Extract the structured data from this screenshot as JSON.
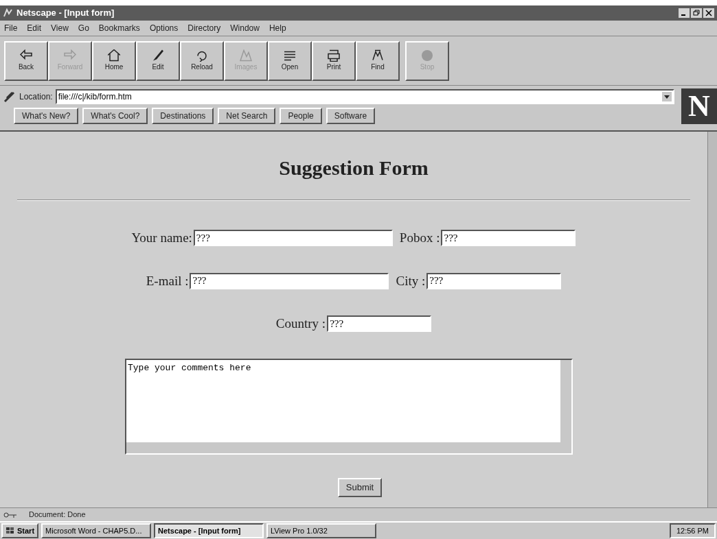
{
  "window": {
    "title": "Netscape - [Input form]"
  },
  "menu": [
    "File",
    "Edit",
    "View",
    "Go",
    "Bookmarks",
    "Options",
    "Directory",
    "Window",
    "Help"
  ],
  "toolbar": [
    {
      "label": "Back",
      "kind": "back",
      "disabled": false
    },
    {
      "label": "Forward",
      "kind": "forward",
      "disabled": true
    },
    {
      "label": "Home",
      "kind": "home",
      "disabled": false
    },
    {
      "label": "Edit",
      "kind": "edit",
      "disabled": false
    },
    {
      "label": "Reload",
      "kind": "reload",
      "disabled": false
    },
    {
      "label": "Images",
      "kind": "images",
      "disabled": true
    },
    {
      "label": "Open",
      "kind": "open",
      "disabled": false
    },
    {
      "label": "Print",
      "kind": "print",
      "disabled": false
    },
    {
      "label": "Find",
      "kind": "find",
      "disabled": false
    },
    {
      "label": "Stop",
      "kind": "stop",
      "disabled": true
    }
  ],
  "location": {
    "label": "Location:",
    "value": "file:///c|/kib/form.htm"
  },
  "logo": "N",
  "directory_buttons": [
    "What's New?",
    "What's Cool?",
    "Destinations",
    "Net Search",
    "People",
    "Software"
  ],
  "page": {
    "heading": "Suggestion Form",
    "rows": [
      [
        {
          "label": "Your name:",
          "value": "???"
        },
        {
          "label": "Pobox :",
          "value": "???"
        }
      ],
      [
        {
          "label": "E-mail :",
          "value": "???"
        },
        {
          "label": "City :",
          "value": "???"
        }
      ],
      [
        {
          "label": "Country :",
          "value": "???"
        }
      ]
    ],
    "comments": "Type your comments here",
    "submit": "Submit"
  },
  "status_bar": {
    "text": "Document: Done"
  },
  "taskbar": {
    "start": "Start",
    "tasks": [
      {
        "label": "Microsoft Word - CHAP5.D...",
        "selected": false
      },
      {
        "label": "Netscape - [Input form]",
        "selected": true
      },
      {
        "label": "LView Pro 1.0/32",
        "selected": false
      }
    ],
    "clock": "12:56 PM"
  }
}
